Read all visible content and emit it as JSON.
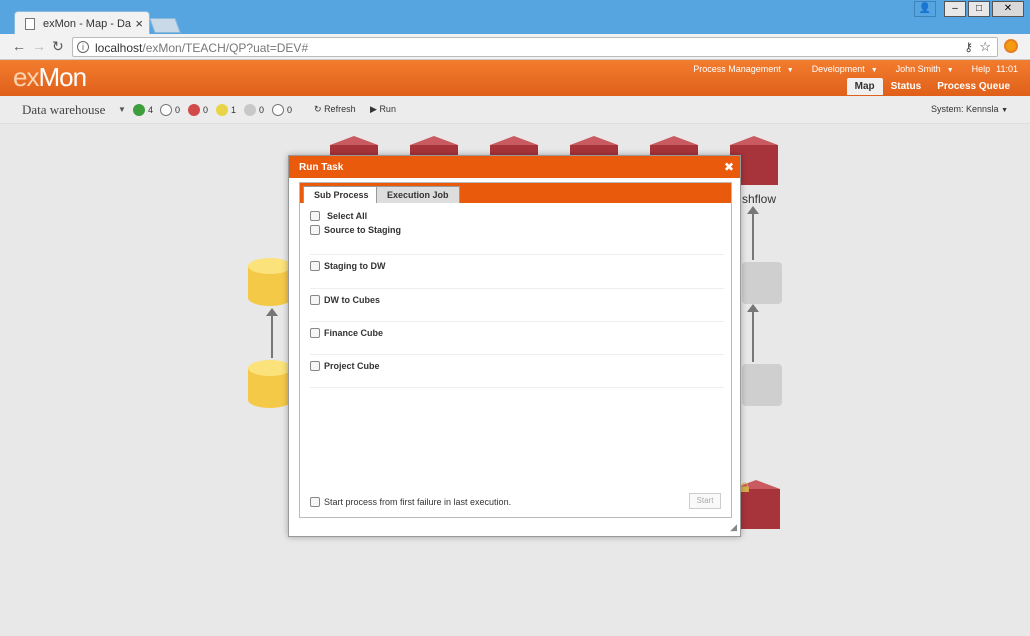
{
  "browser": {
    "tab_title": "exMon - Map - Data warehouse",
    "url_host": "localhost",
    "url_path": "/exMon/TEACH/QP?uat=DEV#",
    "window_buttons": {
      "minimize": "–",
      "maximize": "□",
      "close": "✕",
      "user": "👤"
    }
  },
  "app": {
    "logo_ex": "ex",
    "logo_mon": "Mon",
    "top_menu": [
      "Process Management",
      "Development",
      "John Smith",
      "Help"
    ],
    "time": "11:01",
    "tabs": [
      "Map",
      "Status",
      "Process Queue"
    ],
    "active_tab": "Map"
  },
  "subbar": {
    "title": "Data warehouse",
    "stats": [
      {
        "color": "#3e9e3e",
        "value": "4",
        "ring": false
      },
      {
        "color": "#ffffff",
        "value": "0",
        "ring": true
      },
      {
        "color": "#d24b4b",
        "value": "0",
        "ring": false
      },
      {
        "color": "#e9d447",
        "value": "1",
        "ring": false
      },
      {
        "color": "#c8c8c8",
        "value": "0",
        "ring": false
      },
      {
        "color": "#ffffff",
        "value": "0",
        "ring": true
      }
    ],
    "refresh_label": "Refresh",
    "run_label": "Run",
    "system_label": "System: Kennsla"
  },
  "canvas": {
    "partial_label": "shflow"
  },
  "dialog": {
    "title": "Run Task",
    "tabs": [
      "Sub Process",
      "Execution Job"
    ],
    "select_all": "Select All",
    "items": [
      "Source to Staging",
      "Staging to DW",
      "DW to Cubes",
      "Finance Cube",
      "Project Cube"
    ],
    "footer_text": "Start process from first failure in last execution.",
    "start_label": "Start"
  }
}
